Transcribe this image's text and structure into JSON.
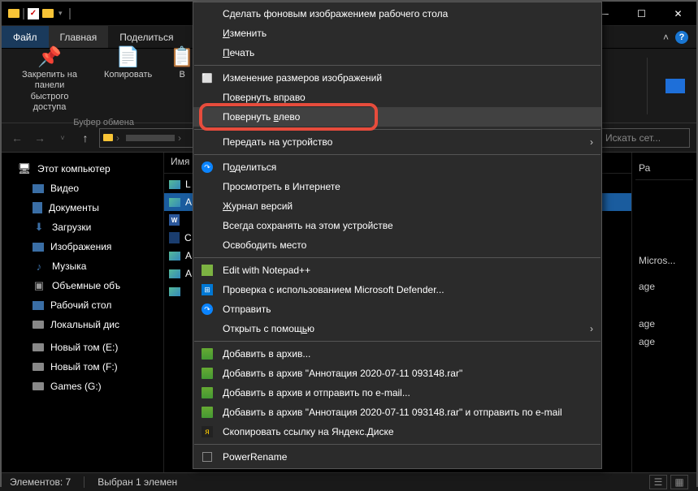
{
  "titlebar": {},
  "tabs": {
    "file": "Файл",
    "home": "Главная",
    "share": "Поделиться"
  },
  "ribbon": {
    "pin": "Закрепить на панели\nбыстрого доступа",
    "copy": "Копировать",
    "paste": "В",
    "clipboard_group": "Буфер обмена"
  },
  "addrbar": {
    "search_placeholder": "Искать сет..."
  },
  "sidebar": {
    "items": [
      {
        "label": "Этот компьютер"
      },
      {
        "label": "Видео"
      },
      {
        "label": "Документы"
      },
      {
        "label": "Загрузки"
      },
      {
        "label": "Изображения"
      },
      {
        "label": "Музыка"
      },
      {
        "label": "Объемные объ"
      },
      {
        "label": "Рабочий стол"
      },
      {
        "label": "Локальный дис"
      },
      {
        "label": "Новый том (E:)"
      },
      {
        "label": "Новый том (F:)"
      },
      {
        "label": "Games (G:)"
      }
    ]
  },
  "columns": {
    "name": "Имя",
    "right": "Ра"
  },
  "files": {
    "rows": [
      "L",
      "A",
      "",
      "C",
      "A",
      "A",
      ""
    ]
  },
  "right_col": {
    "cells": [
      "Micros...",
      "age",
      "age",
      "age"
    ]
  },
  "statusbar": {
    "count": "Элементов: 7",
    "selected": "Выбран 1 элемен"
  },
  "context_menu": {
    "items": [
      {
        "label": "Сделать фоновым изображением рабочего стола",
        "icon": ""
      },
      {
        "label": "Изменить",
        "underline": 0,
        "icon": ""
      },
      {
        "label": "Печать",
        "underline": 0,
        "icon": ""
      },
      {
        "sep": true
      },
      {
        "label": "Изменение размеров изображений",
        "icon": "resize"
      },
      {
        "label": "Повернуть вправо",
        "icon": ""
      },
      {
        "label": "Повернуть влево",
        "underline": 10,
        "icon": "",
        "highlighted": true,
        "red_box": true
      },
      {
        "sep": true
      },
      {
        "label": "Передать на устройство",
        "icon": "",
        "submenu": true
      },
      {
        "sep": true
      },
      {
        "label": "Поделиться",
        "underline": 1,
        "icon": "share"
      },
      {
        "label": "Просмотреть в Интернете",
        "icon": ""
      },
      {
        "label": "Журнал версий",
        "underline": 0,
        "icon": ""
      },
      {
        "label": "Всегда сохранять на этом устройстве",
        "icon": ""
      },
      {
        "label": "Освободить место",
        "icon": ""
      },
      {
        "sep": true
      },
      {
        "label": "Edit with Notepad++",
        "icon": "npp"
      },
      {
        "label": "Проверка с использованием Microsoft Defender...",
        "icon": "def"
      },
      {
        "label": "Отправить",
        "icon": "share"
      },
      {
        "label": "Открыть с помощью",
        "underline": 15,
        "icon": "",
        "submenu": true
      },
      {
        "sep": true
      },
      {
        "label": "Добавить в архив...",
        "icon": "rar"
      },
      {
        "label": "Добавить в архив \"Аннотация 2020-07-11 093148.rar\"",
        "icon": "rar"
      },
      {
        "label": "Добавить в архив и отправить по e-mail...",
        "icon": "rar"
      },
      {
        "label": "Добавить в архив \"Аннотация 2020-07-11 093148.rar\" и отправить по e-mail",
        "icon": "rar"
      },
      {
        "label": "Скопировать ссылку на Яндекс.Диске",
        "icon": "yd"
      },
      {
        "sep": true
      },
      {
        "label": "PowerRename",
        "icon": "rename"
      }
    ]
  }
}
